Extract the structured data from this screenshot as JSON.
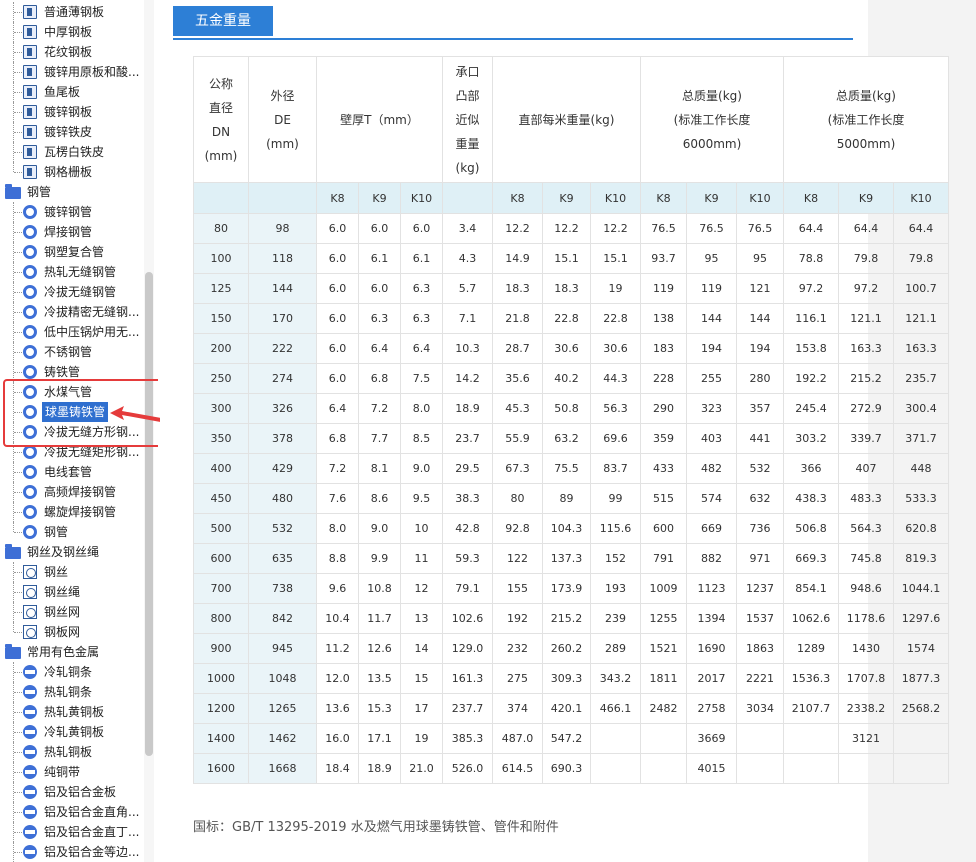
{
  "sidebar": {
    "items": [
      {
        "label": "普通薄钢板",
        "icon": "steel-plate-icon",
        "type": "leaf-doc"
      },
      {
        "label": "中厚钢板",
        "icon": "steel-plate-icon",
        "type": "leaf-doc"
      },
      {
        "label": "花纹钢板",
        "icon": "steel-plate-icon",
        "type": "leaf-doc"
      },
      {
        "label": "镀锌用原板和酸...",
        "icon": "steel-plate-icon",
        "type": "leaf-doc"
      },
      {
        "label": "鱼尾板",
        "icon": "steel-plate-icon",
        "type": "leaf-doc"
      },
      {
        "label": "镀锌钢板",
        "icon": "steel-plate-icon",
        "type": "leaf-doc"
      },
      {
        "label": "镀锌铁皮",
        "icon": "steel-plate-icon",
        "type": "leaf-doc"
      },
      {
        "label": "瓦楞白铁皮",
        "icon": "steel-plate-icon",
        "type": "leaf-doc"
      },
      {
        "label": "钢格栅板",
        "icon": "steel-plate-icon",
        "type": "leaf-doc",
        "last": true
      },
      {
        "label": "钢管",
        "icon": "folder-icon",
        "type": "folder"
      },
      {
        "label": "镀锌钢管",
        "icon": "pipe-circle-icon",
        "type": "leaf-circle"
      },
      {
        "label": "焊接钢管",
        "icon": "pipe-circle-icon",
        "type": "leaf-circle"
      },
      {
        "label": "钢塑复合管",
        "icon": "pipe-circle-icon",
        "type": "leaf-circle"
      },
      {
        "label": "热轧无缝钢管",
        "icon": "pipe-circle-icon",
        "type": "leaf-circle"
      },
      {
        "label": "冷拔无缝钢管",
        "icon": "pipe-circle-icon",
        "type": "leaf-circle"
      },
      {
        "label": "冷拔精密无缝钢...",
        "icon": "pipe-circle-icon",
        "type": "leaf-circle"
      },
      {
        "label": "低中压锅炉用无...",
        "icon": "pipe-circle-icon",
        "type": "leaf-circle"
      },
      {
        "label": "不锈钢管",
        "icon": "pipe-circle-icon",
        "type": "leaf-circle"
      },
      {
        "label": "铸铁管",
        "icon": "pipe-circle-icon",
        "type": "leaf-circle"
      },
      {
        "label": "水煤气管",
        "icon": "pipe-circle-icon",
        "type": "leaf-circle"
      },
      {
        "label": "球墨铸铁管",
        "icon": "pipe-circle-icon",
        "type": "leaf-circle",
        "selected": true
      },
      {
        "label": "冷拔无缝方形钢...",
        "icon": "pipe-circle-icon",
        "type": "leaf-circle"
      },
      {
        "label": "冷拔无缝矩形钢...",
        "icon": "pipe-circle-icon",
        "type": "leaf-circle"
      },
      {
        "label": "电线套管",
        "icon": "pipe-circle-icon",
        "type": "leaf-circle"
      },
      {
        "label": "高频焊接钢管",
        "icon": "pipe-circle-icon",
        "type": "leaf-circle"
      },
      {
        "label": "螺旋焊接钢管",
        "icon": "pipe-circle-icon",
        "type": "leaf-circle"
      },
      {
        "label": "钢管",
        "icon": "pipe-circle-icon",
        "type": "leaf-circle",
        "last": true
      },
      {
        "label": "钢丝及钢丝绳",
        "icon": "folder-icon",
        "type": "folder"
      },
      {
        "label": "钢丝",
        "icon": "wire-rope-icon",
        "type": "leaf-rope"
      },
      {
        "label": "钢丝绳",
        "icon": "wire-rope-icon",
        "type": "leaf-rope"
      },
      {
        "label": "钢丝网",
        "icon": "wire-rope-icon",
        "type": "leaf-rope"
      },
      {
        "label": "钢板网",
        "icon": "wire-rope-icon",
        "type": "leaf-rope",
        "last": true
      },
      {
        "label": "常用有色金属",
        "icon": "folder-icon",
        "type": "folder"
      },
      {
        "label": "冷轧铜条",
        "icon": "metal-bar-icon",
        "type": "leaf-bar"
      },
      {
        "label": "热轧铜条",
        "icon": "metal-bar-icon",
        "type": "leaf-bar"
      },
      {
        "label": "热轧黄铜板",
        "icon": "metal-bar-icon",
        "type": "leaf-bar"
      },
      {
        "label": "冷轧黄铜板",
        "icon": "metal-bar-icon",
        "type": "leaf-bar"
      },
      {
        "label": "热轧铜板",
        "icon": "metal-bar-icon",
        "type": "leaf-bar"
      },
      {
        "label": "纯铜带",
        "icon": "metal-bar-icon",
        "type": "leaf-bar"
      },
      {
        "label": "铝及铝合金板",
        "icon": "metal-bar-icon",
        "type": "leaf-bar"
      },
      {
        "label": "铝及铝合金直角...",
        "icon": "metal-bar-icon",
        "type": "leaf-bar"
      },
      {
        "label": "铝及铝合金直丁...",
        "icon": "metal-bar-icon",
        "type": "leaf-bar"
      },
      {
        "label": "铝及铝合金等边...",
        "icon": "metal-bar-icon",
        "type": "leaf-bar"
      }
    ]
  },
  "tab": {
    "label": "五金重量"
  },
  "accent_color": "#2d7fd6",
  "highlight_color": "#e53b3b",
  "table": {
    "header": {
      "dn_lines": [
        "公称",
        "直径",
        "DN",
        "(mm)"
      ],
      "de_lines": [
        "外径",
        "DE",
        "(mm)"
      ],
      "wall": "壁厚T（mm）",
      "socket_lines": [
        "承口",
        "凸部",
        "近似",
        "重量",
        "(kg)"
      ],
      "straight": "直部每米重量(kg)",
      "total6_lines": [
        "总质量(kg)",
        "(标准工作长度",
        "6000mm)"
      ],
      "total5_lines": [
        "总质量(kg)",
        "(标准工作长度",
        "5000mm)"
      ]
    },
    "subheader": [
      "",
      "",
      "K8",
      "K9",
      "K10",
      "",
      "K8",
      "K9",
      "K10",
      "K8",
      "K9",
      "K10",
      "K8",
      "K9",
      "K10"
    ],
    "rows": [
      [
        "80",
        "98",
        "6.0",
        "6.0",
        "6.0",
        "3.4",
        "12.2",
        "12.2",
        "12.2",
        "76.5",
        "76.5",
        "76.5",
        "64.4",
        "64.4",
        "64.4"
      ],
      [
        "100",
        "118",
        "6.0",
        "6.1",
        "6.1",
        "4.3",
        "14.9",
        "15.1",
        "15.1",
        "93.7",
        "95",
        "95",
        "78.8",
        "79.8",
        "79.8"
      ],
      [
        "125",
        "144",
        "6.0",
        "6.0",
        "6.3",
        "5.7",
        "18.3",
        "18.3",
        "19",
        "119",
        "119",
        "121",
        "97.2",
        "97.2",
        "100.7"
      ],
      [
        "150",
        "170",
        "6.0",
        "6.3",
        "6.3",
        "7.1",
        "21.8",
        "22.8",
        "22.8",
        "138",
        "144",
        "144",
        "116.1",
        "121.1",
        "121.1"
      ],
      [
        "200",
        "222",
        "6.0",
        "6.4",
        "6.4",
        "10.3",
        "28.7",
        "30.6",
        "30.6",
        "183",
        "194",
        "194",
        "153.8",
        "163.3",
        "163.3"
      ],
      [
        "250",
        "274",
        "6.0",
        "6.8",
        "7.5",
        "14.2",
        "35.6",
        "40.2",
        "44.3",
        "228",
        "255",
        "280",
        "192.2",
        "215.2",
        "235.7"
      ],
      [
        "300",
        "326",
        "6.4",
        "7.2",
        "8.0",
        "18.9",
        "45.3",
        "50.8",
        "56.3",
        "290",
        "323",
        "357",
        "245.4",
        "272.9",
        "300.4"
      ],
      [
        "350",
        "378",
        "6.8",
        "7.7",
        "8.5",
        "23.7",
        "55.9",
        "63.2",
        "69.6",
        "359",
        "403",
        "441",
        "303.2",
        "339.7",
        "371.7"
      ],
      [
        "400",
        "429",
        "7.2",
        "8.1",
        "9.0",
        "29.5",
        "67.3",
        "75.5",
        "83.7",
        "433",
        "482",
        "532",
        "366",
        "407",
        "448"
      ],
      [
        "450",
        "480",
        "7.6",
        "8.6",
        "9.5",
        "38.3",
        "80",
        "89",
        "99",
        "515",
        "574",
        "632",
        "438.3",
        "483.3",
        "533.3"
      ],
      [
        "500",
        "532",
        "8.0",
        "9.0",
        "10",
        "42.8",
        "92.8",
        "104.3",
        "115.6",
        "600",
        "669",
        "736",
        "506.8",
        "564.3",
        "620.8"
      ],
      [
        "600",
        "635",
        "8.8",
        "9.9",
        "11",
        "59.3",
        "122",
        "137.3",
        "152",
        "791",
        "882",
        "971",
        "669.3",
        "745.8",
        "819.3"
      ],
      [
        "700",
        "738",
        "9.6",
        "10.8",
        "12",
        "79.1",
        "155",
        "173.9",
        "193",
        "1009",
        "1123",
        "1237",
        "854.1",
        "948.6",
        "1044.1"
      ],
      [
        "800",
        "842",
        "10.4",
        "11.7",
        "13",
        "102.6",
        "192",
        "215.2",
        "239",
        "1255",
        "1394",
        "1537",
        "1062.6",
        "1178.6",
        "1297.6"
      ],
      [
        "900",
        "945",
        "11.2",
        "12.6",
        "14",
        "129.0",
        "232",
        "260.2",
        "289",
        "1521",
        "1690",
        "1863",
        "1289",
        "1430",
        "1574"
      ],
      [
        "1000",
        "1048",
        "12.0",
        "13.5",
        "15",
        "161.3",
        "275",
        "309.3",
        "343.2",
        "1811",
        "2017",
        "2221",
        "1536.3",
        "1707.8",
        "1877.3"
      ],
      [
        "1200",
        "1265",
        "13.6",
        "15.3",
        "17",
        "237.7",
        "374",
        "420.1",
        "466.1",
        "2482",
        "2758",
        "3034",
        "2107.7",
        "2338.2",
        "2568.2"
      ],
      [
        "1400",
        "1462",
        "16.0",
        "17.1",
        "19",
        "385.3",
        "487.0",
        "547.2",
        "",
        "",
        "3669",
        "",
        "",
        "3121",
        ""
      ],
      [
        "1600",
        "1668",
        "18.4",
        "18.9",
        "21.0",
        "526.0",
        "614.5",
        "690.3",
        "",
        "",
        "4015",
        "",
        "",
        "",
        ""
      ]
    ]
  },
  "footnote": "国标：GB/T 13295-2019 水及燃气用球墨铸铁管、管件和附件"
}
